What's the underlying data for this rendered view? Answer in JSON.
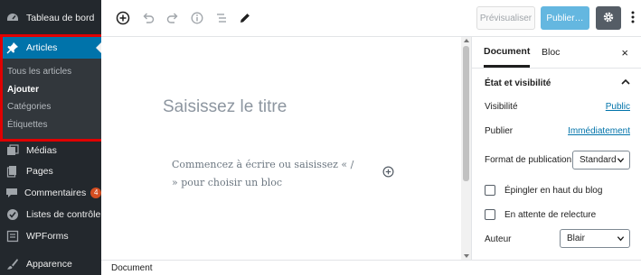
{
  "sidebar": {
    "items": [
      {
        "label": "Tableau de bord",
        "icon": "dashboard-icon"
      },
      {
        "label": "Articles",
        "icon": "pin-icon"
      },
      {
        "label": "Médias",
        "icon": "media-icon"
      },
      {
        "label": "Pages",
        "icon": "pages-icon"
      },
      {
        "label": "Commentaires",
        "icon": "comment-icon",
        "badge": "4"
      },
      {
        "label": "Listes de contrôle",
        "icon": "checklist-icon"
      },
      {
        "label": "WPForms",
        "icon": "forms-icon"
      },
      {
        "label": "Apparence",
        "icon": "brush-icon"
      }
    ],
    "submenu": [
      {
        "label": "Tous les articles"
      },
      {
        "label": "Ajouter"
      },
      {
        "label": "Catégories"
      },
      {
        "label": "Étiquettes"
      }
    ]
  },
  "toolbar": {
    "preview_label": "Prévisualiser",
    "publish_label": "Publier…"
  },
  "editor": {
    "title_placeholder": "Saisissez le titre",
    "paragraph_placeholder": "Commencez à écrire ou saisissez « / » pour choisir un bloc"
  },
  "panel": {
    "tabs": [
      "Document",
      "Bloc"
    ],
    "close_label": "×",
    "section_title": "État et visibilité",
    "visibility_label": "Visibilité",
    "visibility_value": "Public",
    "publish_label": "Publier",
    "publish_value": "Immédiatement",
    "format_label": "Format de publication",
    "format_value": "Standard",
    "sticky_label": "Épingler en haut du blog",
    "pending_label": "En attente de relecture",
    "author_label": "Auteur",
    "author_value": "Blair"
  },
  "footer": {
    "breadcrumb": "Document"
  },
  "colors": {
    "sidebar_bg": "#23282d",
    "active_menu": "#0073aa",
    "highlight": "#e00000",
    "publish_button": "#64b7e0",
    "settings_button": "#555d66",
    "link": "#0073aa"
  }
}
